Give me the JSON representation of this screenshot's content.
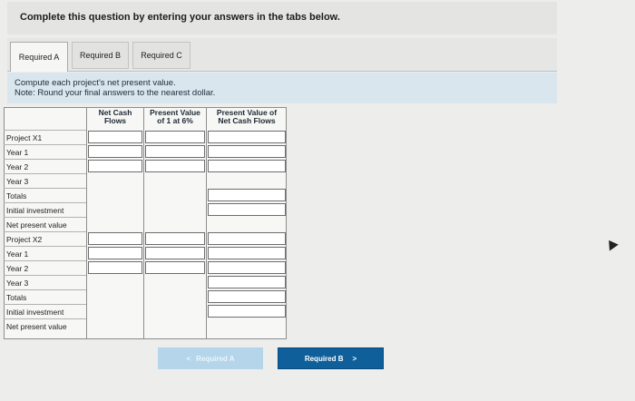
{
  "header": {
    "prompt": "Complete this question by entering your answers in the tabs below."
  },
  "tabs": [
    {
      "label": "Required A",
      "active": true
    },
    {
      "label": "Required B",
      "active": false
    },
    {
      "label": "Required C",
      "active": false
    }
  ],
  "instructions": {
    "line1": "Compute each project's net present value.",
    "line2": "Note: Round your final answers to the nearest dollar."
  },
  "table": {
    "columns": [
      {
        "line1": "Net Cash",
        "line2": "Flows"
      },
      {
        "line1": "Present Value",
        "line2": "of 1 at 6%"
      },
      {
        "line1": "Present Value of",
        "line2": "Net Cash Flows"
      }
    ],
    "rows": [
      {
        "label": "Project X1",
        "inputs": [
          true,
          true,
          true
        ]
      },
      {
        "label": "Year 1",
        "inputs": [
          true,
          true,
          true
        ]
      },
      {
        "label": "Year 2",
        "inputs": [
          true,
          true,
          true
        ]
      },
      {
        "label": "Year 3",
        "inputs": [
          false,
          false,
          false
        ]
      },
      {
        "label": "Totals",
        "inputs": [
          false,
          false,
          true
        ]
      },
      {
        "label": "Initial investment",
        "inputs": [
          false,
          false,
          true
        ]
      },
      {
        "label": "Net present value",
        "inputs": [
          false,
          false,
          false
        ]
      },
      {
        "label": "Project X2",
        "inputs": [
          true,
          true,
          true
        ]
      },
      {
        "label": "Year 1",
        "inputs": [
          true,
          true,
          true
        ]
      },
      {
        "label": "Year 2",
        "inputs": [
          true,
          true,
          true
        ]
      },
      {
        "label": "Year 3",
        "inputs": [
          false,
          false,
          true
        ]
      },
      {
        "label": "Totals",
        "inputs": [
          false,
          false,
          true
        ]
      },
      {
        "label": "Initial investment",
        "inputs": [
          false,
          false,
          true
        ]
      },
      {
        "label": "Net present value",
        "inputs": [
          false,
          false,
          false
        ]
      }
    ]
  },
  "navigation": {
    "prev_label": "Required A",
    "next_label": "Required B",
    "prev_icon": "<",
    "next_icon": ">"
  },
  "colors": {
    "accent": "#0f5f9a",
    "accent_light": "#b4d5ea",
    "banner": "#dae6ee"
  }
}
